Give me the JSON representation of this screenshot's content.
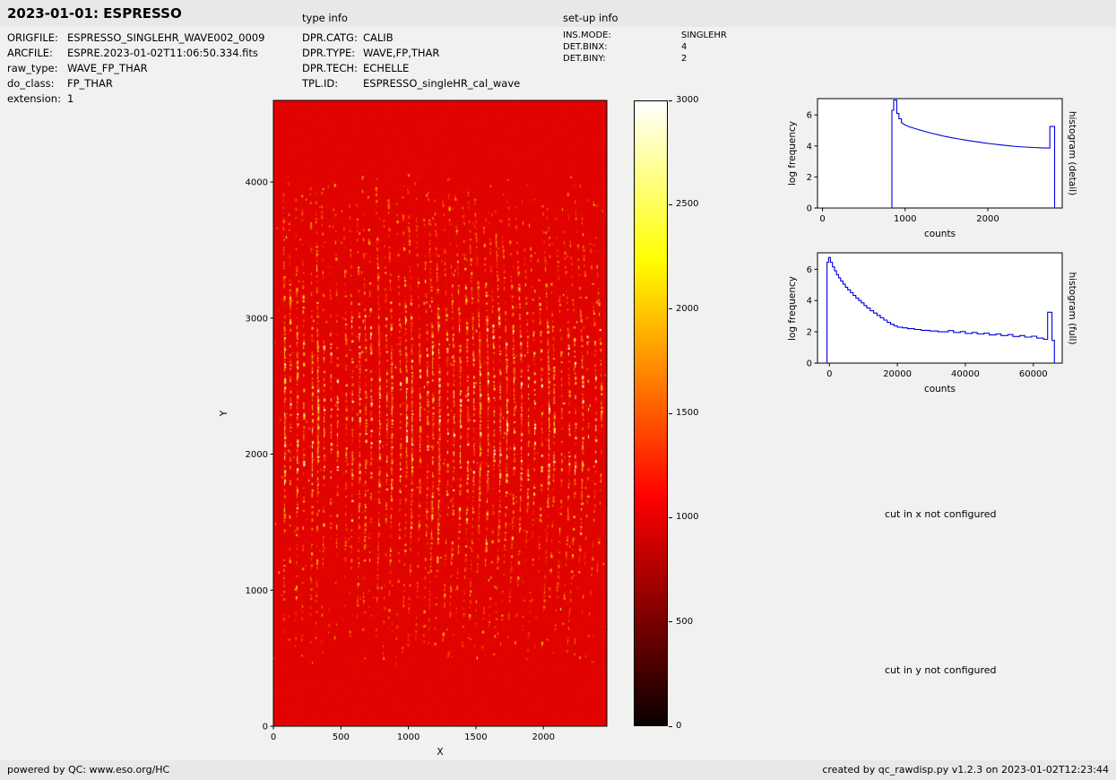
{
  "header": {
    "title": "2023-01-01: ESPRESSO",
    "type_info_label": "type info",
    "setup_info_label": "set-up info"
  },
  "file_info": {
    "rows": [
      {
        "label": "ORIGFILE:",
        "value": "ESPRESSO_SINGLEHR_WAVE002_0009"
      },
      {
        "label": "ARCFILE:",
        "value": "ESPRE.2023-01-02T11:06:50.334.fits"
      },
      {
        "label": "raw_type:",
        "value": "WAVE_FP_THAR"
      },
      {
        "label": "do_class:",
        "value": "FP_THAR"
      },
      {
        "label": "extension:",
        "value": "1"
      }
    ]
  },
  "type_info": {
    "rows": [
      {
        "label": "DPR.CATG:",
        "value": "CALIB"
      },
      {
        "label": "DPR.TYPE:",
        "value": "WAVE,FP,THAR"
      },
      {
        "label": "DPR.TECH:",
        "value": "ECHELLE"
      },
      {
        "label": "TPL.ID:",
        "value": "ESPRESSO_singleHR_cal_wave"
      }
    ]
  },
  "setup_info": {
    "rows": [
      {
        "label": "INS.MODE:",
        "value": "SINGLEHR"
      },
      {
        "label": "DET.BINX:",
        "value": "4"
      },
      {
        "label": "DET.BINY:",
        "value": "2"
      }
    ]
  },
  "messages": {
    "cut_x": "cut in x not configured",
    "cut_y": "cut in y not configured"
  },
  "footer": {
    "left": "powered by QC: www.eso.org/HC",
    "right": "created by qc_rawdisp.py v1.2.3 on 2023-01-02T12:23:44"
  },
  "chart_data": [
    {
      "type": "heatmap",
      "name": "raw frame display",
      "xlabel": "X",
      "ylabel": "Y",
      "xlim": [
        0,
        2470
      ],
      "ylim": [
        0,
        4600
      ],
      "xticks": [
        0,
        500,
        1000,
        1500,
        2000
      ],
      "yticks": [
        0,
        1000,
        2000,
        3000,
        4000
      ],
      "colormap": "hot",
      "colorbar": {
        "range": [
          0,
          3000
        ],
        "ticks": [
          0,
          500,
          1000,
          1500,
          2000,
          2500,
          3000
        ]
      },
      "description": "Raw ESPRESSO echelle FP/ThAr calibration frame: uniform background near 1000 counts (red) covered by dotted vertical emission-line order stripes between Y~500 and Y~4100; stripe density and brightness peak in the middle of the detector."
    },
    {
      "type": "line",
      "name": "histogram (detail)",
      "xlabel": "counts",
      "ylabel": "log frequency",
      "xlim": [
        -60,
        2900
      ],
      "ylim": [
        0,
        7.05
      ],
      "xticks": [
        0,
        1000,
        2000
      ],
      "yticks": [
        0,
        2,
        4,
        6
      ],
      "line_color": "#0000dd",
      "points": [
        [
          -60,
          0
        ],
        [
          840,
          0
        ],
        [
          840,
          6.3
        ],
        [
          862,
          6.3
        ],
        [
          862,
          6.95
        ],
        [
          898,
          6.95
        ],
        [
          898,
          6.1
        ],
        [
          925,
          6.1
        ],
        [
          925,
          5.75
        ],
        [
          955,
          5.75
        ],
        [
          955,
          5.5
        ],
        [
          1000,
          5.35
        ],
        [
          1060,
          5.22
        ],
        [
          1120,
          5.12
        ],
        [
          1180,
          5.02
        ],
        [
          1250,
          4.92
        ],
        [
          1320,
          4.82
        ],
        [
          1400,
          4.72
        ],
        [
          1480,
          4.62
        ],
        [
          1560,
          4.53
        ],
        [
          1650,
          4.45
        ],
        [
          1750,
          4.36
        ],
        [
          1850,
          4.28
        ],
        [
          1950,
          4.2
        ],
        [
          2050,
          4.13
        ],
        [
          2150,
          4.07
        ],
        [
          2250,
          4.01
        ],
        [
          2350,
          3.96
        ],
        [
          2450,
          3.93
        ],
        [
          2550,
          3.9
        ],
        [
          2650,
          3.88
        ],
        [
          2750,
          3.86
        ],
        [
          2750,
          5.25
        ],
        [
          2808,
          5.25
        ],
        [
          2808,
          0
        ]
      ]
    },
    {
      "type": "line",
      "name": "histogram (full)",
      "xlabel": "counts",
      "ylabel": "log frequency",
      "xlim": [
        -3500,
        68500
      ],
      "ylim": [
        0,
        7.05
      ],
      "xticks": [
        0,
        20000,
        40000,
        60000
      ],
      "yticks": [
        0,
        2,
        4,
        6
      ],
      "line_color": "#0000dd",
      "points": [
        [
          -700,
          0
        ],
        [
          -700,
          6.45
        ],
        [
          -250,
          6.45
        ],
        [
          -250,
          6.75
        ],
        [
          300,
          6.75
        ],
        [
          300,
          6.45
        ],
        [
          900,
          6.45
        ],
        [
          900,
          6.15
        ],
        [
          1500,
          6.15
        ],
        [
          1500,
          5.9
        ],
        [
          2100,
          5.9
        ],
        [
          2100,
          5.65
        ],
        [
          2700,
          5.65
        ],
        [
          2700,
          5.45
        ],
        [
          3300,
          5.45
        ],
        [
          3300,
          5.25
        ],
        [
          4000,
          5.25
        ],
        [
          4000,
          5.05
        ],
        [
          4700,
          5.05
        ],
        [
          4700,
          4.85
        ],
        [
          5400,
          4.85
        ],
        [
          5400,
          4.68
        ],
        [
          6200,
          4.68
        ],
        [
          6200,
          4.5
        ],
        [
          7000,
          4.5
        ],
        [
          7000,
          4.32
        ],
        [
          7800,
          4.32
        ],
        [
          7800,
          4.15
        ],
        [
          8600,
          4.15
        ],
        [
          8600,
          4.0
        ],
        [
          9400,
          4.0
        ],
        [
          9400,
          3.85
        ],
        [
          10200,
          3.85
        ],
        [
          10200,
          3.68
        ],
        [
          11000,
          3.68
        ],
        [
          11000,
          3.52
        ],
        [
          12000,
          3.52
        ],
        [
          12000,
          3.35
        ],
        [
          13000,
          3.35
        ],
        [
          13000,
          3.2
        ],
        [
          14000,
          3.2
        ],
        [
          14000,
          3.05
        ],
        [
          15000,
          3.05
        ],
        [
          15000,
          2.9
        ],
        [
          16000,
          2.9
        ],
        [
          16000,
          2.75
        ],
        [
          17000,
          2.75
        ],
        [
          17000,
          2.6
        ],
        [
          18000,
          2.6
        ],
        [
          18000,
          2.48
        ],
        [
          19000,
          2.48
        ],
        [
          19000,
          2.38
        ],
        [
          20000,
          2.38
        ],
        [
          20000,
          2.3
        ],
        [
          21500,
          2.3
        ],
        [
          21500,
          2.25
        ],
        [
          23000,
          2.25
        ],
        [
          23000,
          2.2
        ],
        [
          25000,
          2.2
        ],
        [
          25000,
          2.15
        ],
        [
          27000,
          2.15
        ],
        [
          27000,
          2.1
        ],
        [
          29500,
          2.1
        ],
        [
          29500,
          2.05
        ],
        [
          32000,
          2.05
        ],
        [
          32000,
          2.0
        ],
        [
          35000,
          2.0
        ],
        [
          35000,
          2.08
        ],
        [
          36500,
          2.08
        ],
        [
          36500,
          1.96
        ],
        [
          38500,
          1.96
        ],
        [
          38500,
          2.02
        ],
        [
          40000,
          2.02
        ],
        [
          40000,
          1.9
        ],
        [
          42000,
          1.9
        ],
        [
          42000,
          1.96
        ],
        [
          43500,
          1.96
        ],
        [
          43500,
          1.86
        ],
        [
          45500,
          1.86
        ],
        [
          45500,
          1.92
        ],
        [
          47000,
          1.92
        ],
        [
          47000,
          1.8
        ],
        [
          49000,
          1.8
        ],
        [
          49000,
          1.86
        ],
        [
          50500,
          1.86
        ],
        [
          50500,
          1.76
        ],
        [
          52500,
          1.76
        ],
        [
          52500,
          1.82
        ],
        [
          54000,
          1.82
        ],
        [
          54000,
          1.7
        ],
        [
          56000,
          1.7
        ],
        [
          56000,
          1.76
        ],
        [
          57500,
          1.76
        ],
        [
          57500,
          1.66
        ],
        [
          59500,
          1.66
        ],
        [
          59500,
          1.72
        ],
        [
          61000,
          1.72
        ],
        [
          61000,
          1.6
        ],
        [
          63000,
          1.6
        ],
        [
          63000,
          1.52
        ],
        [
          64200,
          1.52
        ],
        [
          64200,
          3.25
        ],
        [
          65500,
          3.25
        ],
        [
          65500,
          1.45
        ],
        [
          66200,
          1.45
        ],
        [
          66200,
          0
        ]
      ]
    }
  ]
}
